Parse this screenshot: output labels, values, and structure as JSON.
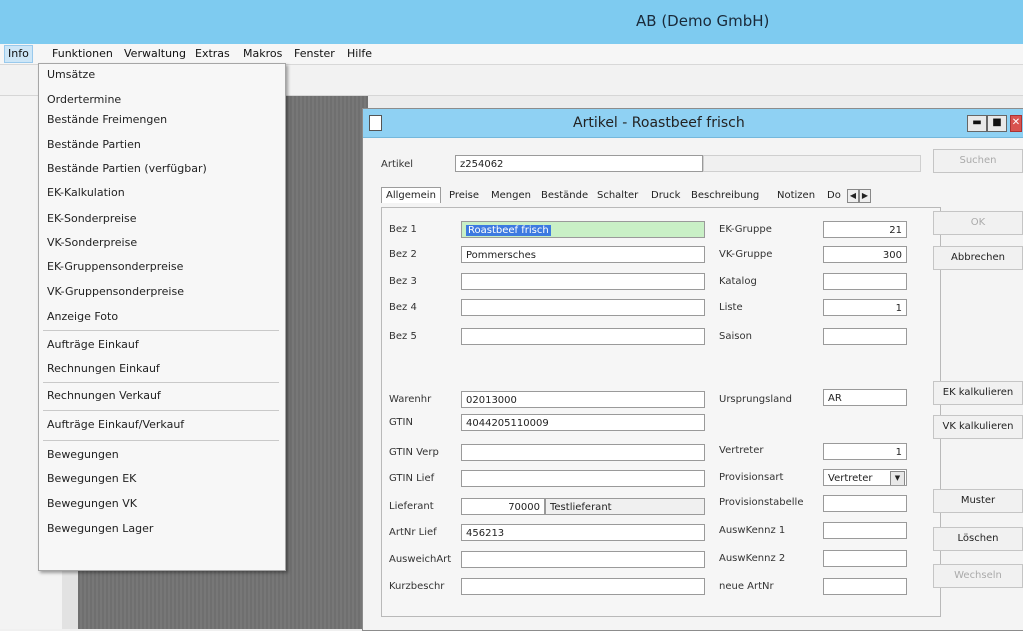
{
  "app": {
    "title": "AB (Demo GmbH)"
  },
  "menubar": [
    {
      "label": "Info"
    },
    {
      "label": "Funktionen"
    },
    {
      "label": "Verwaltung"
    },
    {
      "label": "Extras"
    },
    {
      "label": "Makros"
    },
    {
      "label": "Fenster"
    },
    {
      "label": "Hilfe"
    }
  ],
  "info_menu": [
    {
      "label": "Umsätze"
    },
    {
      "label": "Ordertermine"
    },
    {
      "label": "Bestände Freimengen"
    },
    {
      "label": "Bestände Partien"
    },
    {
      "label": "Bestände Partien (verfügbar)"
    },
    {
      "label": "EK-Kalkulation"
    },
    {
      "label": "EK-Sonderpreise"
    },
    {
      "label": "VK-Sonderpreise"
    },
    {
      "label": "EK-Gruppensonderpreise"
    },
    {
      "label": "VK-Gruppensonderpreise"
    },
    {
      "label": "Anzeige Foto"
    },
    {
      "label": "Aufträge Einkauf"
    },
    {
      "label": "Rechnungen Einkauf"
    },
    {
      "label": "Rechnungen Verkauf"
    },
    {
      "label": "Aufträge Einkauf/Verkauf"
    },
    {
      "label": "Bewegungen"
    },
    {
      "label": "Bewegungen EK"
    },
    {
      "label": "Bewegungen VK"
    },
    {
      "label": "Bewegungen Lager"
    }
  ],
  "window": {
    "title": "Artikel - Roastbeef frisch",
    "artikel_label": "Artikel",
    "artikel_value": "z254062",
    "tabs": [
      {
        "label": "Allgemein"
      },
      {
        "label": "Preise"
      },
      {
        "label": "Mengen"
      },
      {
        "label": "Bestände"
      },
      {
        "label": "Schalter"
      },
      {
        "label": "Druck"
      },
      {
        "label": "Beschreibung"
      },
      {
        "label": "Notizen"
      },
      {
        "label": "Do"
      }
    ],
    "left_fields": [
      {
        "label": "Bez 1",
        "value": "Roastbeef frisch"
      },
      {
        "label": "Bez 2",
        "value": "Pommersches"
      },
      {
        "label": "Bez 3",
        "value": ""
      },
      {
        "label": "Bez 4",
        "value": ""
      },
      {
        "label": "Bez 5",
        "value": ""
      }
    ],
    "right_fields": [
      {
        "label": "EK-Gruppe",
        "value": "21"
      },
      {
        "label": "VK-Gruppe",
        "value": "300"
      },
      {
        "label": "Katalog",
        "value": ""
      },
      {
        "label": "Liste",
        "value": "1"
      },
      {
        "label": "Saison",
        "value": ""
      }
    ],
    "left_fields2": [
      {
        "label": "Warenhr",
        "value": "02013000"
      },
      {
        "label": "GTIN",
        "value": "4044205110009"
      },
      {
        "label": "GTIN Verp",
        "value": ""
      },
      {
        "label": "GTIN Lief",
        "value": ""
      },
      {
        "label": "Lieferant",
        "value": "70000",
        "extra": "Testlieferant"
      },
      {
        "label": "ArtNr Lief",
        "value": "456213"
      },
      {
        "label": "AusweichArt",
        "value": ""
      },
      {
        "label": "Kurzbeschr",
        "value": ""
      }
    ],
    "right_fields2": [
      {
        "label": "Ursprungsland",
        "value": "AR"
      },
      {
        "label": "Vertreter",
        "value": "1"
      },
      {
        "label": "Provisionsart",
        "value": "Vertreter"
      },
      {
        "label": "Provisionstabelle",
        "value": ""
      },
      {
        "label": "AuswKennz 1",
        "value": ""
      },
      {
        "label": "AuswKennz 2",
        "value": ""
      },
      {
        "label": "neue ArtNr",
        "value": ""
      }
    ],
    "buttons": {
      "suchen": "Suchen",
      "ok": "OK",
      "abbrechen": "Abbrechen",
      "ek_kalkulieren": "EK kalkulieren",
      "vk_kalkulieren": "VK kalkulieren",
      "muster": "Muster",
      "loeschen": "Löschen",
      "wechseln": "Wechseln"
    }
  }
}
